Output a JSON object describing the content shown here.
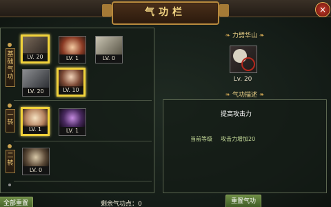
{
  "window": {
    "title": "气功栏",
    "close_symbol": "×"
  },
  "tiers": [
    {
      "label": "基础气功"
    },
    {
      "label": "一转"
    },
    {
      "label": "二转"
    }
  ],
  "skills": [
    {
      "lv": "LV. 20",
      "selected": true
    },
    {
      "lv": "LV. 1",
      "selected": false
    },
    {
      "lv": "LV. 0",
      "selected": false
    },
    {
      "lv": "LV. 20",
      "selected": false
    },
    {
      "lv": "LV. 10",
      "selected": true
    },
    {
      "lv": "LV. 1",
      "selected": true
    },
    {
      "lv": "LV. 1",
      "selected": false
    },
    {
      "lv": "LV. 0",
      "selected": false
    }
  ],
  "detail": {
    "skill_name": "力劈华山",
    "skill_lv": "Lv. 20",
    "section_title": "气功描述",
    "description": "提高攻击力",
    "current_level_label": "当前等级",
    "current_effect": "攻击力增加20"
  },
  "buttons": {
    "reset_all": "全部重置",
    "reset_qigong": "重置气功"
  },
  "remaining_points": "剩余气功点：0",
  "colors": {
    "accent_gold": "#f4d784",
    "button_green": "#6d8c45",
    "selected_border": "#f1d23a"
  }
}
